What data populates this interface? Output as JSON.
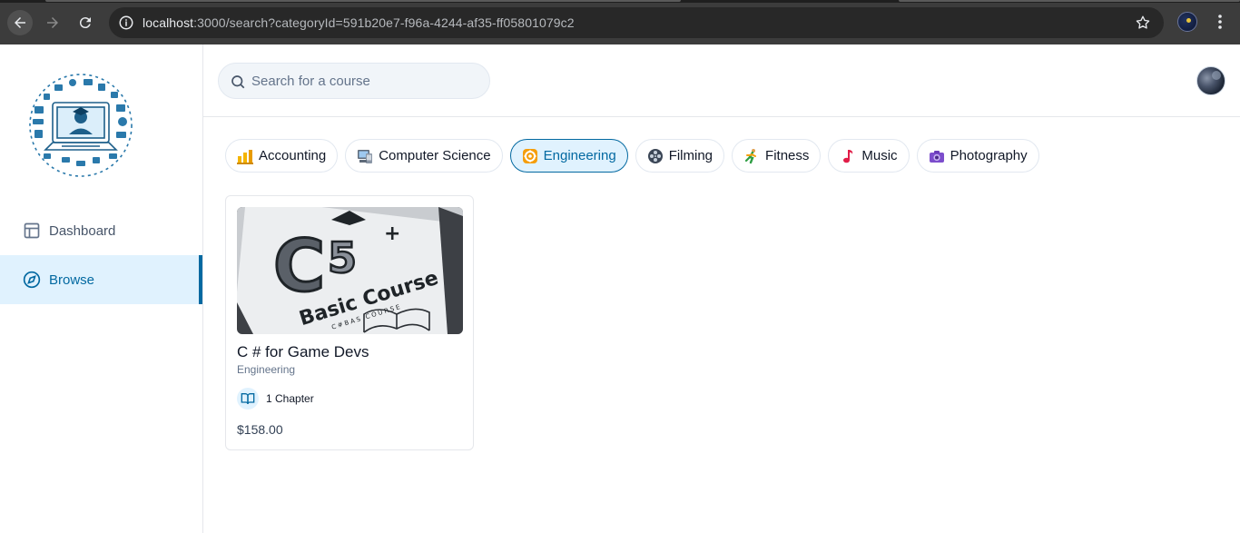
{
  "browser": {
    "url_host": "localhost",
    "url_rest": ":3000/search?categoryId=591b20e7-f96a-4244-af35-ff05801079c2",
    "icons": [
      "back-arrow-icon",
      "forward-arrow-icon",
      "reload-icon",
      "site-info-icon",
      "bookmark-star-icon",
      "extension-icon",
      "more-menu-icon"
    ]
  },
  "sidebar": {
    "items": [
      {
        "label": "Dashboard",
        "icon": "layout-icon",
        "active": false
      },
      {
        "label": "Browse",
        "icon": "compass-icon",
        "active": true
      }
    ]
  },
  "header": {
    "search": {
      "placeholder": "Search for a course",
      "value": ""
    }
  },
  "categories": [
    {
      "label": "Accounting",
      "icon": "bar-chart-emoji-icon",
      "active": false
    },
    {
      "label": "Computer Science",
      "icon": "computer-emoji-icon",
      "active": false
    },
    {
      "label": "Engineering",
      "icon": "gear-emoji-icon",
      "active": true
    },
    {
      "label": "Filming",
      "icon": "film-reel-emoji-icon",
      "active": false
    },
    {
      "label": "Fitness",
      "icon": "runner-emoji-icon",
      "active": false
    },
    {
      "label": "Music",
      "icon": "music-note-emoji-icon",
      "active": false
    },
    {
      "label": "Photography",
      "icon": "camera-emoji-icon",
      "active": false
    }
  ],
  "courses": [
    {
      "title": "C # for Game Devs",
      "category": "Engineering",
      "chapters": "1 Chapter",
      "price": "$158.00",
      "thumbnail": {
        "big_text": "C#",
        "subtitle": "Basic Course",
        "small_text": "C#BAS   COURSE"
      }
    }
  ],
  "colors": {
    "accent": "#0369a1",
    "accent_bg": "#e0f2fe",
    "browser_bar": "#3c3c3c"
  }
}
